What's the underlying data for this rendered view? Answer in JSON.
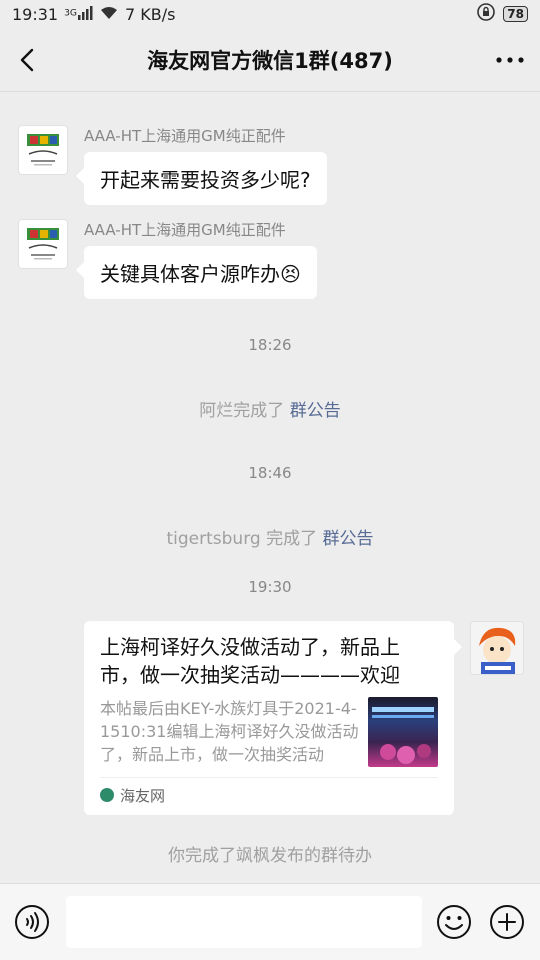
{
  "status_bar": {
    "time": "19:31",
    "net_type": "3G",
    "speed": "7 KB/s",
    "battery": "78"
  },
  "header": {
    "title": "海友网官方微信1群(487)"
  },
  "messages": [
    {
      "sender": "AAA-HT上海通用GM纯正配件",
      "text": "开起来需要投资多少呢?"
    },
    {
      "sender": "AAA-HT上海通用GM纯正配件",
      "text": "关键具体客户源咋办😣"
    }
  ],
  "timestamps": [
    "18:26",
    "18:46",
    "19:30"
  ],
  "system_notices": [
    {
      "prefix": "阿烂完成了 ",
      "link": "群公告"
    },
    {
      "prefix": "tigertsburg 完成了 ",
      "link": "群公告"
    },
    {
      "text": "你完成了飒枫发布的群待办"
    }
  ],
  "card": {
    "title": "上海柯译好久没做活动了，新品上市，做一次抽奖活动————欢迎",
    "desc": "本帖最后由KEY-水族灯具于2021-4-1510:31编辑上海柯译好久没做活动了，新品上市，做一次抽奖活动",
    "source": "海友网"
  },
  "icons": {
    "back": "chevron-left-icon",
    "more": "more-dots-icon",
    "voice": "voice-icon",
    "emoji": "emoji-icon",
    "plus": "plus-icon"
  },
  "colors": {
    "background": "#ededed",
    "link": "#576b95",
    "bubble": "#ffffff"
  }
}
